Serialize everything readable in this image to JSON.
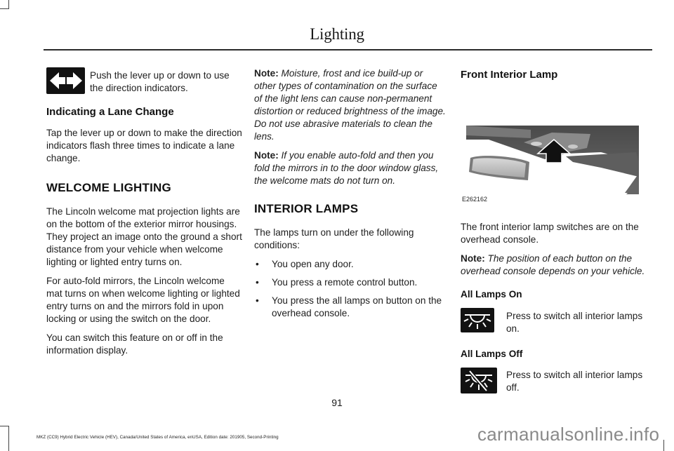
{
  "header": {
    "title": "Lighting"
  },
  "column1": {
    "direction_indicator": {
      "icon": "direction-indicator-arrows-icon",
      "text": "Push the lever up or down to use the direction indicators."
    },
    "lane_change": {
      "heading": "Indicating a Lane Change",
      "text": "Tap the lever up or down to make the direction indicators flash three times to indicate a lane change."
    },
    "welcome_lighting": {
      "heading": "WELCOME LIGHTING",
      "paragraphs": [
        "The Lincoln welcome mat projection lights are on the bottom of the exterior mirror housings. They project an image onto the ground a short distance from your vehicle when welcome lighting or lighted entry turns on.",
        "For auto-fold mirrors, the Lincoln welcome mat turns on when welcome lighting or lighted entry turns on and the mirrors fold in upon locking or using the switch on the door.",
        "You can switch this feature on or off in the information display."
      ]
    }
  },
  "column2": {
    "notes": [
      {
        "label": "Note:",
        "text": "Moisture, frost and ice build-up or other types of contamination on the surface of the light lens can cause non-permanent distortion or reduced brightness of the image. Do not use abrasive materials to clean the lens."
      },
      {
        "label": "Note:",
        "text": "If you enable auto-fold and then you fold the mirrors in to the door window glass, the welcome mats do not turn on."
      }
    ],
    "interior_lamps": {
      "heading": "INTERIOR LAMPS",
      "intro": "The lamps turn on under the following conditions:",
      "bullet_glyph": "•",
      "conditions": [
        "You open any door.",
        "You press a remote control button.",
        "You press the all lamps on button on the overhead console."
      ]
    }
  },
  "column3": {
    "front_lamp": {
      "heading": "Front Interior Lamp",
      "figure_id": "E262162",
      "figure_description": "overhead-console-with-rearview-mirror-and-arrow",
      "text": "The front interior lamp switches are on the overhead console.",
      "note": {
        "label": "Note:",
        "text": "The position of each button on the overhead console depends on your vehicle."
      }
    },
    "all_lamps_on": {
      "heading": "All Lamps On",
      "icon": "all-lamps-on-icon",
      "text": "Press to switch all interior lamps on."
    },
    "all_lamps_off": {
      "heading": "All Lamps Off",
      "icon": "all-lamps-off-icon",
      "text": "Press to switch all interior lamps off."
    }
  },
  "footer": {
    "page_number": "91",
    "edition_text": "MKZ (CC9) Hybrid Electric Vehicle (HEV), Canada/United States of America, enUSA, Edition date: 201905, Second-Printing",
    "watermark": "carmanualsonline.info"
  }
}
